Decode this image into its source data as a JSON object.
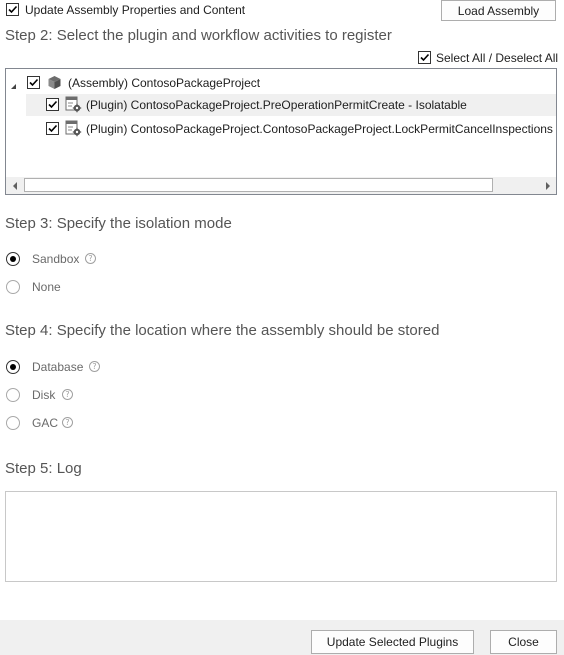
{
  "top": {
    "update_checkbox_label": "Update Assembly Properties and Content",
    "update_checked": true,
    "load_button_label": "Load Assembly"
  },
  "step2": {
    "title": "Step 2: Select the plugin and workflow activities to register",
    "select_all_label": "Select All / Deselect All",
    "select_all_checked": true,
    "tree": {
      "assembly": {
        "label": "(Assembly) ContosoPackageProject",
        "checked": true,
        "icon": "package-icon"
      },
      "plugins": [
        {
          "label": "(Plugin) ContosoPackageProject.PreOperationPermitCreate - Isolatable",
          "checked": true,
          "icon": "plugin-gear-icon"
        },
        {
          "label": "(Plugin) ContosoPackageProject.ContosoPackageProject.LockPermitCancelInspections - Is",
          "checked": true,
          "icon": "plugin-gear-icon"
        }
      ]
    }
  },
  "step3": {
    "title": "Step 3: Specify the isolation mode",
    "options": [
      {
        "label": "Sandbox",
        "selected": true
      },
      {
        "label": "None",
        "selected": false
      }
    ]
  },
  "step4": {
    "title": "Step 4: Specify the location where the assembly should be stored",
    "options": [
      {
        "label": "Database",
        "selected": true
      },
      {
        "label": "Disk",
        "selected": false
      },
      {
        "label": "GAC",
        "selected": false
      }
    ]
  },
  "step5": {
    "title": "Step 5: Log",
    "log_value": ""
  },
  "footer": {
    "update_button_label": "Update Selected Plugins",
    "close_button_label": "Close"
  },
  "help_glyph": "?",
  "colors": {
    "footer_bg": "#f0f0f0",
    "row_highlight": "#f0f0f0",
    "step_text": "#555555"
  }
}
